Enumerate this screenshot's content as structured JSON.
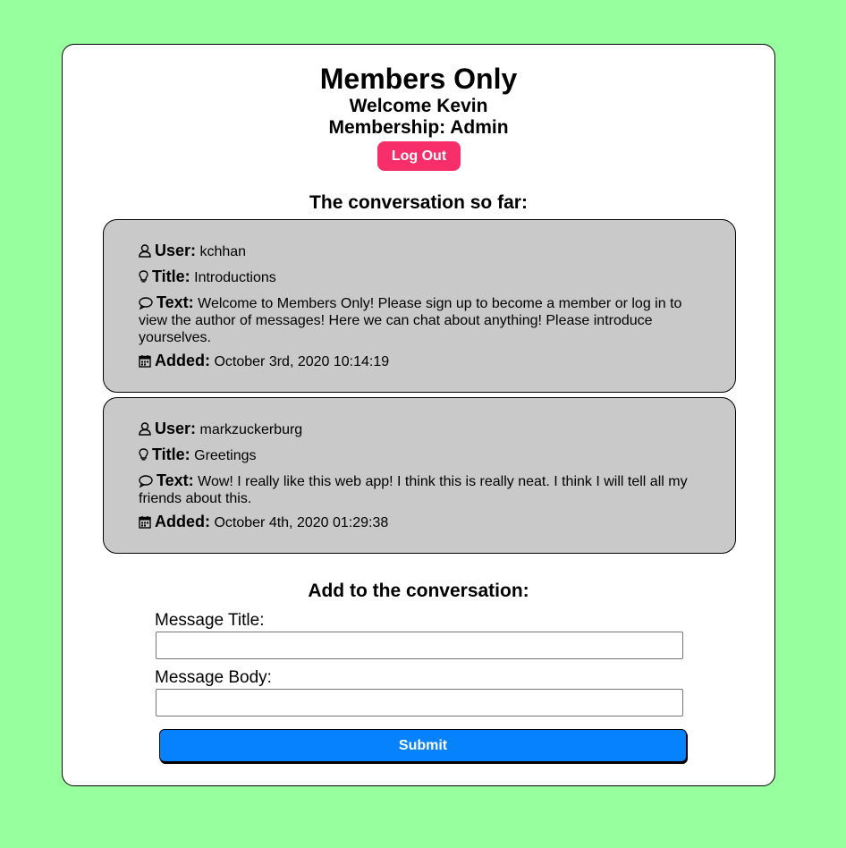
{
  "header": {
    "title": "Members Only",
    "welcome": "Welcome Kevin",
    "membership": "Membership: Admin",
    "logout_label": "Log Out"
  },
  "conversation": {
    "heading": "The conversation so far:",
    "labels": {
      "user": "User:",
      "title": "Title:",
      "text": "Text:",
      "added": "Added:"
    },
    "messages": [
      {
        "user": "kchhan",
        "title": "Introductions",
        "text": "Welcome to Members Only! Please sign up to become a member or log in to view the author of messages! Here we can chat about anything! Please introduce yourselves.",
        "added": "October 3rd, 2020 10:14:19"
      },
      {
        "user": "markzuckerburg",
        "title": "Greetings",
        "text": "Wow! I really like this web app! I think this is really neat. I think I will tell all my friends about this.",
        "added": "October 4th, 2020 01:29:38"
      }
    ]
  },
  "form": {
    "heading": "Add to the conversation:",
    "title_label": "Message Title:",
    "title_value": "",
    "body_label": "Message Body:",
    "body_value": "",
    "submit_label": "Submit"
  },
  "icons": {
    "user": "user-icon",
    "title": "lightbulb-icon",
    "text": "comment-icon",
    "added": "calendar-icon"
  },
  "colors": {
    "page_background": "#98ff9e",
    "message_background": "#c9c9c9",
    "logout_button": "#f72e6a",
    "submit_button": "#0782ff"
  }
}
